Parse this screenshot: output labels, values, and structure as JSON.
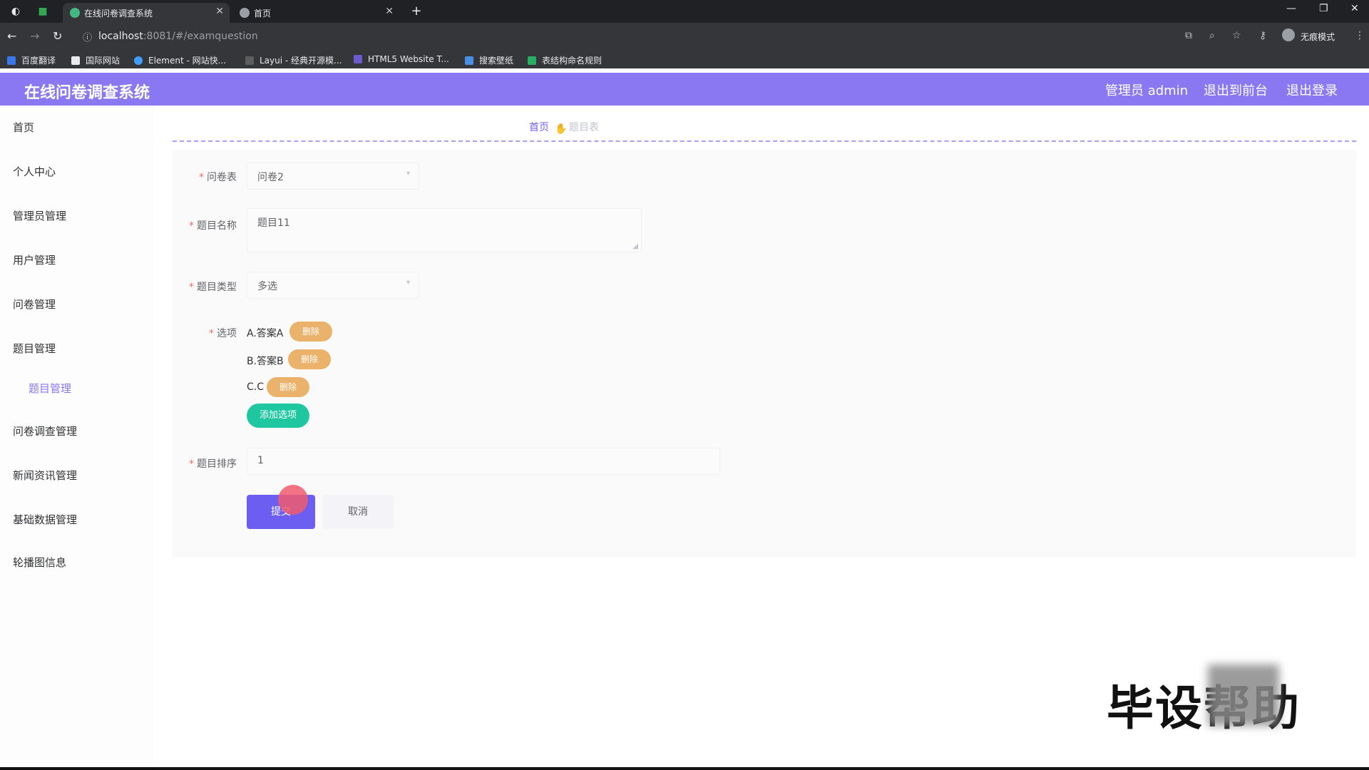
{
  "browser": {
    "tabs": [
      {
        "title": "在线问卷调查系统",
        "active": true
      },
      {
        "title": "首页",
        "active": false
      }
    ],
    "new_tab": "+",
    "url_host": "localhost",
    "url_rest": ":8081/#/examquestion",
    "profile_label": "无痕模式",
    "bookmarks": [
      "百度翻译",
      "国际网站",
      "Element - 网站快...",
      "Layui - 经典开源模...",
      "HTML5 Website T...",
      "搜索壁纸",
      "表结构命名规则"
    ]
  },
  "header": {
    "title": "在线问卷调查系统",
    "admin_label": "管理员 admin",
    "back_label": "退出到前台",
    "logout_label": "退出登录"
  },
  "sidebar": {
    "items": [
      {
        "label": "首页"
      },
      {
        "label": "个人中心"
      },
      {
        "label": "管理员管理"
      },
      {
        "label": "用户管理"
      },
      {
        "label": "问卷管理"
      },
      {
        "label": "题目管理"
      },
      {
        "label": "题目管理"
      },
      {
        "label": "问卷调查管理"
      },
      {
        "label": "新闻资讯管理"
      },
      {
        "label": "基础数据管理"
      },
      {
        "label": "轮播图信息"
      }
    ]
  },
  "breadcrumb": {
    "home": "首页",
    "current": "题目表"
  },
  "form": {
    "survey_label": "问卷表",
    "survey_value": "问卷2",
    "name_label": "题目名称",
    "name_value": "题目11",
    "type_label": "题目类型",
    "type_value": "多选",
    "options_label": "选项",
    "options": [
      {
        "text": "A.答案A",
        "delete": "删除"
      },
      {
        "text": "B.答案B",
        "delete": "删除"
      },
      {
        "text": "C.C",
        "delete": "删除"
      }
    ],
    "add_option": "添加选项",
    "order_label": "题目排序",
    "order_value": "1",
    "submit": "提交",
    "cancel": "取消"
  },
  "watermark": "毕设帮助"
}
